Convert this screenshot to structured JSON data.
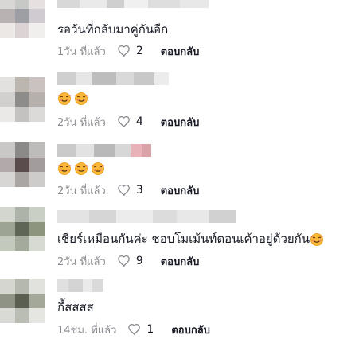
{
  "comments": [
    {
      "text": "รอวันที่กลับมาคู่กันอีก",
      "emoji_count": 0,
      "time": "1วัน ที่แล้ว",
      "likes": "2",
      "reply_label": "ตอบกลับ",
      "avatar_colors": [
        "#d9d7d5",
        "#c6c9c6",
        "#e6e1e0",
        "#b8b3b2",
        "#9e9fa5",
        "#cfcbd1",
        "#ece8e6",
        "#dcd3d4",
        "#f1eeee"
      ],
      "name_colors": [
        "#d8d8d8",
        "#eaeaea",
        "#cfcfcf",
        "#f0f0f0",
        "#dedede",
        "#e8e8e8"
      ]
    },
    {
      "text": "",
      "emoji_count": 2,
      "time": "2วัน ที่แล้ว",
      "likes": "4",
      "reply_label": "ตอบกลับ",
      "avatar_colors": [
        "#e3e1df",
        "#bcb6b0",
        "#c9c2c0",
        "#d2d0cf",
        "#8e8c8b",
        "#b6b0ad",
        "#ebe9e8",
        "#c4c2c1",
        "#dcdad9"
      ],
      "name_colors": [
        "#cfcfcf",
        "#e6e6e6",
        "#bdbdbd",
        "#d9d9d9",
        "#c8c8c8",
        "#ececec"
      ]
    },
    {
      "text": "",
      "emoji_count": 3,
      "time": "2วัน ที่แล้ว",
      "likes": "3",
      "reply_label": "ตอบกลับ",
      "avatar_colors": [
        "#c9c8c6",
        "#8c8a88",
        "#bdbcbb",
        "#b2a9aa",
        "#5a4c4d",
        "#a39c9c",
        "#d8d6d5",
        "#a9a6a4",
        "#cecccb"
      ],
      "name_colors": [
        "#cacaca",
        "#e2e2e2",
        "#b9b9b9",
        "#d7d7d7",
        "#e7b3b8",
        "#d9a1a8"
      ]
    },
    {
      "text": "เชียร์เหมือนกันค่ะ ชอบโมเม้นท์ตอนเค้าอยู่ด้วยกัน",
      "emoji_count": 1,
      "time": "2วัน ที่แล้ว",
      "likes": "9",
      "reply_label": "ตอบกลับ",
      "avatar_colors": [
        "#d2d6cf",
        "#adb3a8",
        "#c9cfc5",
        "#9ea494",
        "#5f6656",
        "#8e957f",
        "#c4c9bd",
        "#a5ab9c",
        "#d6dad2"
      ],
      "name_colors": [
        "#e3e3e3",
        "#d6d6d6",
        "#ececec",
        "#dcdcdc",
        "#e8e8e8",
        "#d1d1d1"
      ]
    },
    {
      "text": "กี้สสสส",
      "emoji_count": 0,
      "time": "14ชม. ที่แล้ว",
      "likes": "1",
      "reply_label": "ตอบกลับ",
      "avatar_colors": [
        "#d5d6d0",
        "#b5b8ae",
        "#e1e2dd",
        "#8f9386",
        "#5a5f52",
        "#a4a899",
        "#d9dad5",
        "#babdb3",
        "#e5e6e2"
      ],
      "name_colors": [
        "#e0e0e0",
        "#d4d4d4",
        "#eaeaea",
        "#dadada"
      ]
    }
  ]
}
